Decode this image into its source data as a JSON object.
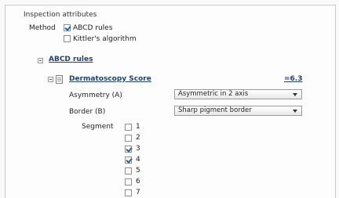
{
  "section_title": "Inspection attributes",
  "method": {
    "label": "Method",
    "options": [
      {
        "label": "ABCD rules",
        "checked": true
      },
      {
        "label": "Kittler's algorithm",
        "checked": false
      }
    ]
  },
  "tree": {
    "group_label": "ABCD rules",
    "score_label": "Dermatoscopy Score",
    "score_value": "=6.3",
    "asymmetry": {
      "label": "Asymmetry (A)",
      "value": "Asymmetric in 2 axis"
    },
    "border": {
      "label": "Border (B)",
      "value": "Sharp pigment border"
    },
    "segment": {
      "label": "Segment",
      "items": [
        {
          "label": "1",
          "checked": false
        },
        {
          "label": "2",
          "checked": false
        },
        {
          "label": "3",
          "checked": true
        },
        {
          "label": "4",
          "checked": true
        },
        {
          "label": "5",
          "checked": false
        },
        {
          "label": "6",
          "checked": false
        },
        {
          "label": "7",
          "checked": false
        }
      ]
    }
  }
}
